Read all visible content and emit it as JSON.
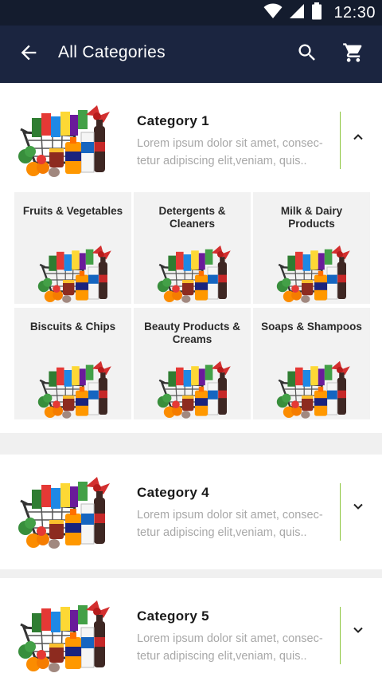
{
  "status_bar": {
    "time": "12:30"
  },
  "app_bar": {
    "title": "All Categories"
  },
  "categories": [
    {
      "title": "Category 1",
      "description": "Lorem ipsum dolor sit amet, consec- tetur adipiscing elit,veniam, quis..",
      "expanded": true,
      "subcategories": [
        {
          "label": "Fruits & Vegetables"
        },
        {
          "label": "Detergents & Cleaners"
        },
        {
          "label": "Milk & Dairy Products"
        },
        {
          "label": "Biscuits & Chips"
        },
        {
          "label": "Beauty Products & Creams"
        },
        {
          "label": "Soaps & Shampoos"
        }
      ]
    },
    {
      "title": "Category 4",
      "description": "Lorem ipsum dolor sit amet, consec- tetur adipiscing elit,veniam, quis..",
      "expanded": false
    },
    {
      "title": "Category 5",
      "description": "Lorem ipsum dolor sit amet, consec- tetur adipiscing elit,veniam, quis..",
      "expanded": false
    }
  ],
  "colors": {
    "status_bar": "#141c2e",
    "app_bar": "#1b2540",
    "accent_divider": "#8dc63f"
  },
  "icons": [
    "wifi-icon",
    "signal-icon",
    "battery-icon",
    "back-arrow-icon",
    "search-icon",
    "cart-icon",
    "chevron-up-icon",
    "chevron-down-icon"
  ]
}
